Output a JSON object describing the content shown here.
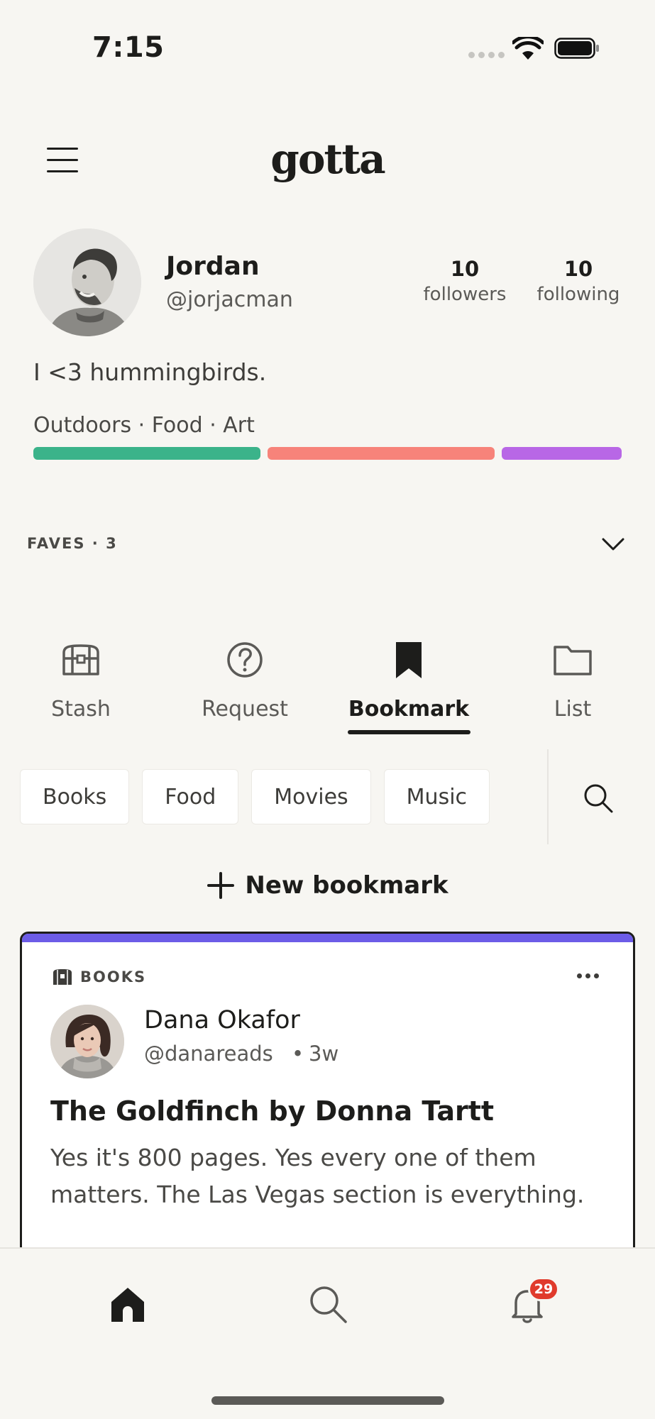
{
  "status_bar": {
    "time": "7:15",
    "icons": [
      "signal-dots-icon",
      "wifi-icon",
      "battery-icon"
    ]
  },
  "header": {
    "logo": "gotta",
    "menu_icon": "hamburger-menu-icon"
  },
  "profile": {
    "name": "Jordan",
    "handle": "@jorjacman",
    "followers": {
      "count": "10",
      "label": "followers"
    },
    "following": {
      "count": "10",
      "label": "following"
    },
    "bio": "I <3 hummingbirds.",
    "interests_text": "Outdoors · Food · Art",
    "interest_bars": [
      {
        "name": "Outdoors",
        "color": "#3bb38a",
        "weight": 1.0
      },
      {
        "name": "Food",
        "color": "#f7837a",
        "weight": 1.0
      },
      {
        "name": "Art",
        "color": "#b867e6",
        "weight": 0.53
      }
    ]
  },
  "faves": {
    "label": "FAVES · 3",
    "expand_icon": "chevron-down-icon"
  },
  "tabs": [
    {
      "label": "Stash",
      "icon": "treasure-chest-icon",
      "active": false
    },
    {
      "label": "Request",
      "icon": "question-circle-icon",
      "active": false
    },
    {
      "label": "Bookmark",
      "icon": "bookmark-icon",
      "active": true
    },
    {
      "label": "List",
      "icon": "folder-icon",
      "active": false
    }
  ],
  "filters": {
    "chips": [
      "Books",
      "Food",
      "Movies",
      "Music"
    ],
    "search_icon": "search-icon"
  },
  "new_bookmark": {
    "label": "New bookmark",
    "icon": "plus-icon"
  },
  "card": {
    "accent_color": "#6c5ce7",
    "category": "BOOKS",
    "category_icon": "books-icon",
    "more_icon": "more-dots-icon",
    "author": "Dana Okafor",
    "handle": "@danareads",
    "separator": "•",
    "time": "3w",
    "title": "The Goldfinch by Donna Tartt",
    "body": "Yes it's 800 pages. Yes every one of them matters. The Las Vegas section is everything."
  },
  "bottom_nav": {
    "items": [
      {
        "name": "home",
        "icon": "home-icon",
        "active": true
      },
      {
        "name": "search",
        "icon": "search-icon",
        "active": false
      },
      {
        "name": "notifications",
        "icon": "bell-icon",
        "active": false
      }
    ],
    "notification_badge": "29"
  }
}
